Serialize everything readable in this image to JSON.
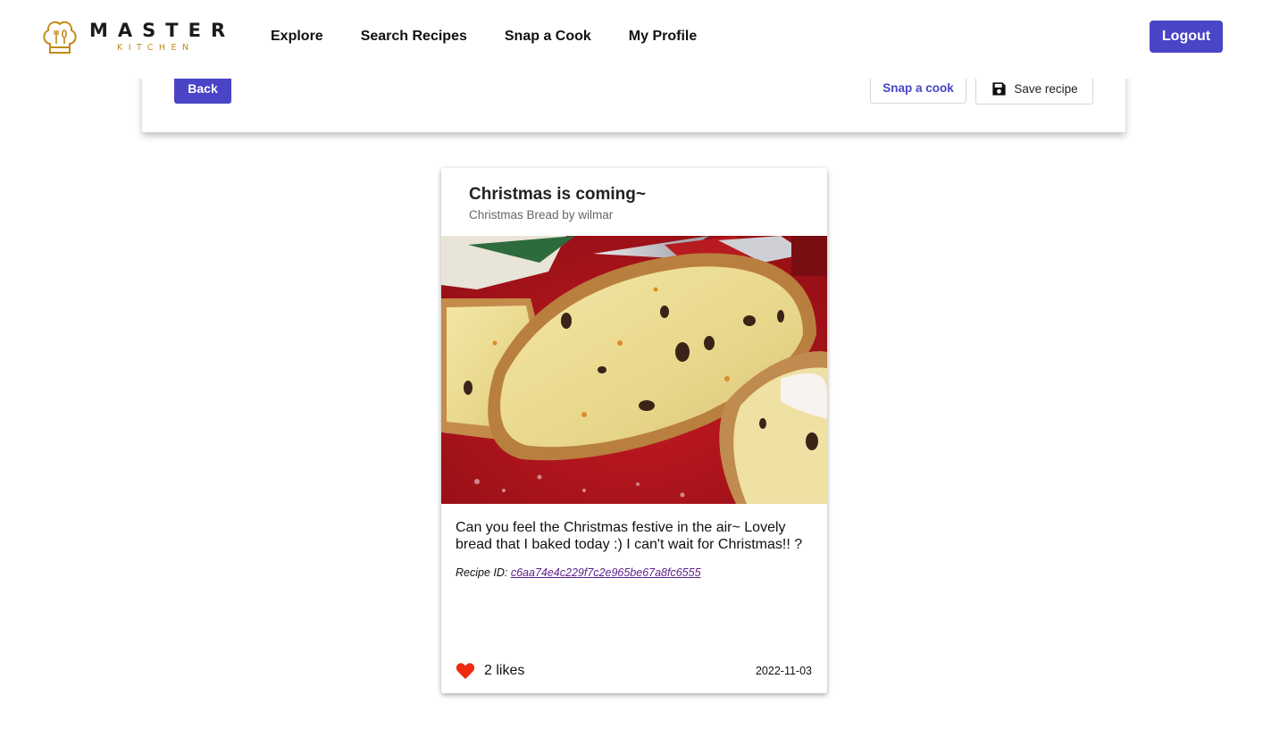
{
  "brand": {
    "name": "MASTER",
    "tagline": "KITCHEN",
    "logo_icon": "chef-hat-icon",
    "accent_color": "#c28a1b"
  },
  "nav": {
    "items": [
      {
        "label": "Explore"
      },
      {
        "label": "Search Recipes"
      },
      {
        "label": "Snap a Cook"
      },
      {
        "label": "My Profile"
      }
    ],
    "logout_label": "Logout",
    "primary_color": "#4a44c7"
  },
  "actions": {
    "back_label": "Back",
    "snap_label": "Snap a cook",
    "save_label": "Save recipe",
    "save_icon": "floppy-disk-icon"
  },
  "recipe": {
    "title": "Christmas is coming~",
    "subtitle": "Christmas Bread by wilmar",
    "image_alt": "Sliced Christmas stollen bread dusted with powdered sugar on a red background",
    "description": "Can you feel the Christmas festive in the air~ Lovely bread that I baked today :) I can't wait for Christmas!! ?",
    "id_label": "Recipe ID:",
    "id_value": "c6aa74e4c229f7c2e965be67a8fc6555",
    "likes_icon": "heart-icon",
    "likes_text": "2 likes",
    "date": "2022-11-03"
  }
}
